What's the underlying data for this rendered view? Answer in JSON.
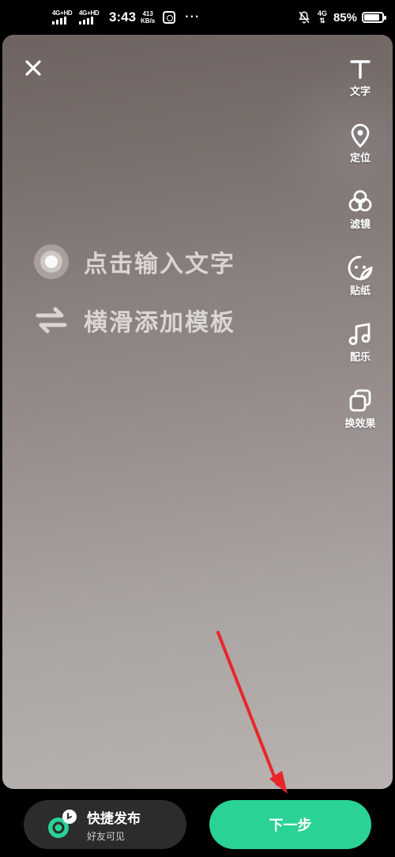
{
  "status_bar": {
    "signal1_label": "4G+HD",
    "signal2_label": "4G+HD",
    "time": "3:43",
    "speed_value": "413",
    "speed_unit": "KB/s",
    "dots": "···",
    "net_label": "4G",
    "battery_percent": "85%",
    "battery_level": 0.85
  },
  "toolbar": {
    "items": [
      {
        "label": "文字",
        "icon": "text-icon"
      },
      {
        "label": "定位",
        "icon": "location-pin-icon"
      },
      {
        "label": "滤镜",
        "icon": "filter-circles-icon"
      },
      {
        "label": "贴纸",
        "icon": "sticker-icon"
      },
      {
        "label": "配乐",
        "icon": "music-note-icon"
      },
      {
        "label": "换效果",
        "icon": "switch-effect-icon"
      }
    ]
  },
  "hints": {
    "tap_input": "点击输入文字",
    "swipe_template": "横滑添加模板"
  },
  "bottom": {
    "quick_publish_title": "快捷发布",
    "quick_publish_sub": "好友可见",
    "next_label": "下一步"
  },
  "colors": {
    "accent_green": "#2ad296",
    "annotation_red": "#e8262a"
  }
}
